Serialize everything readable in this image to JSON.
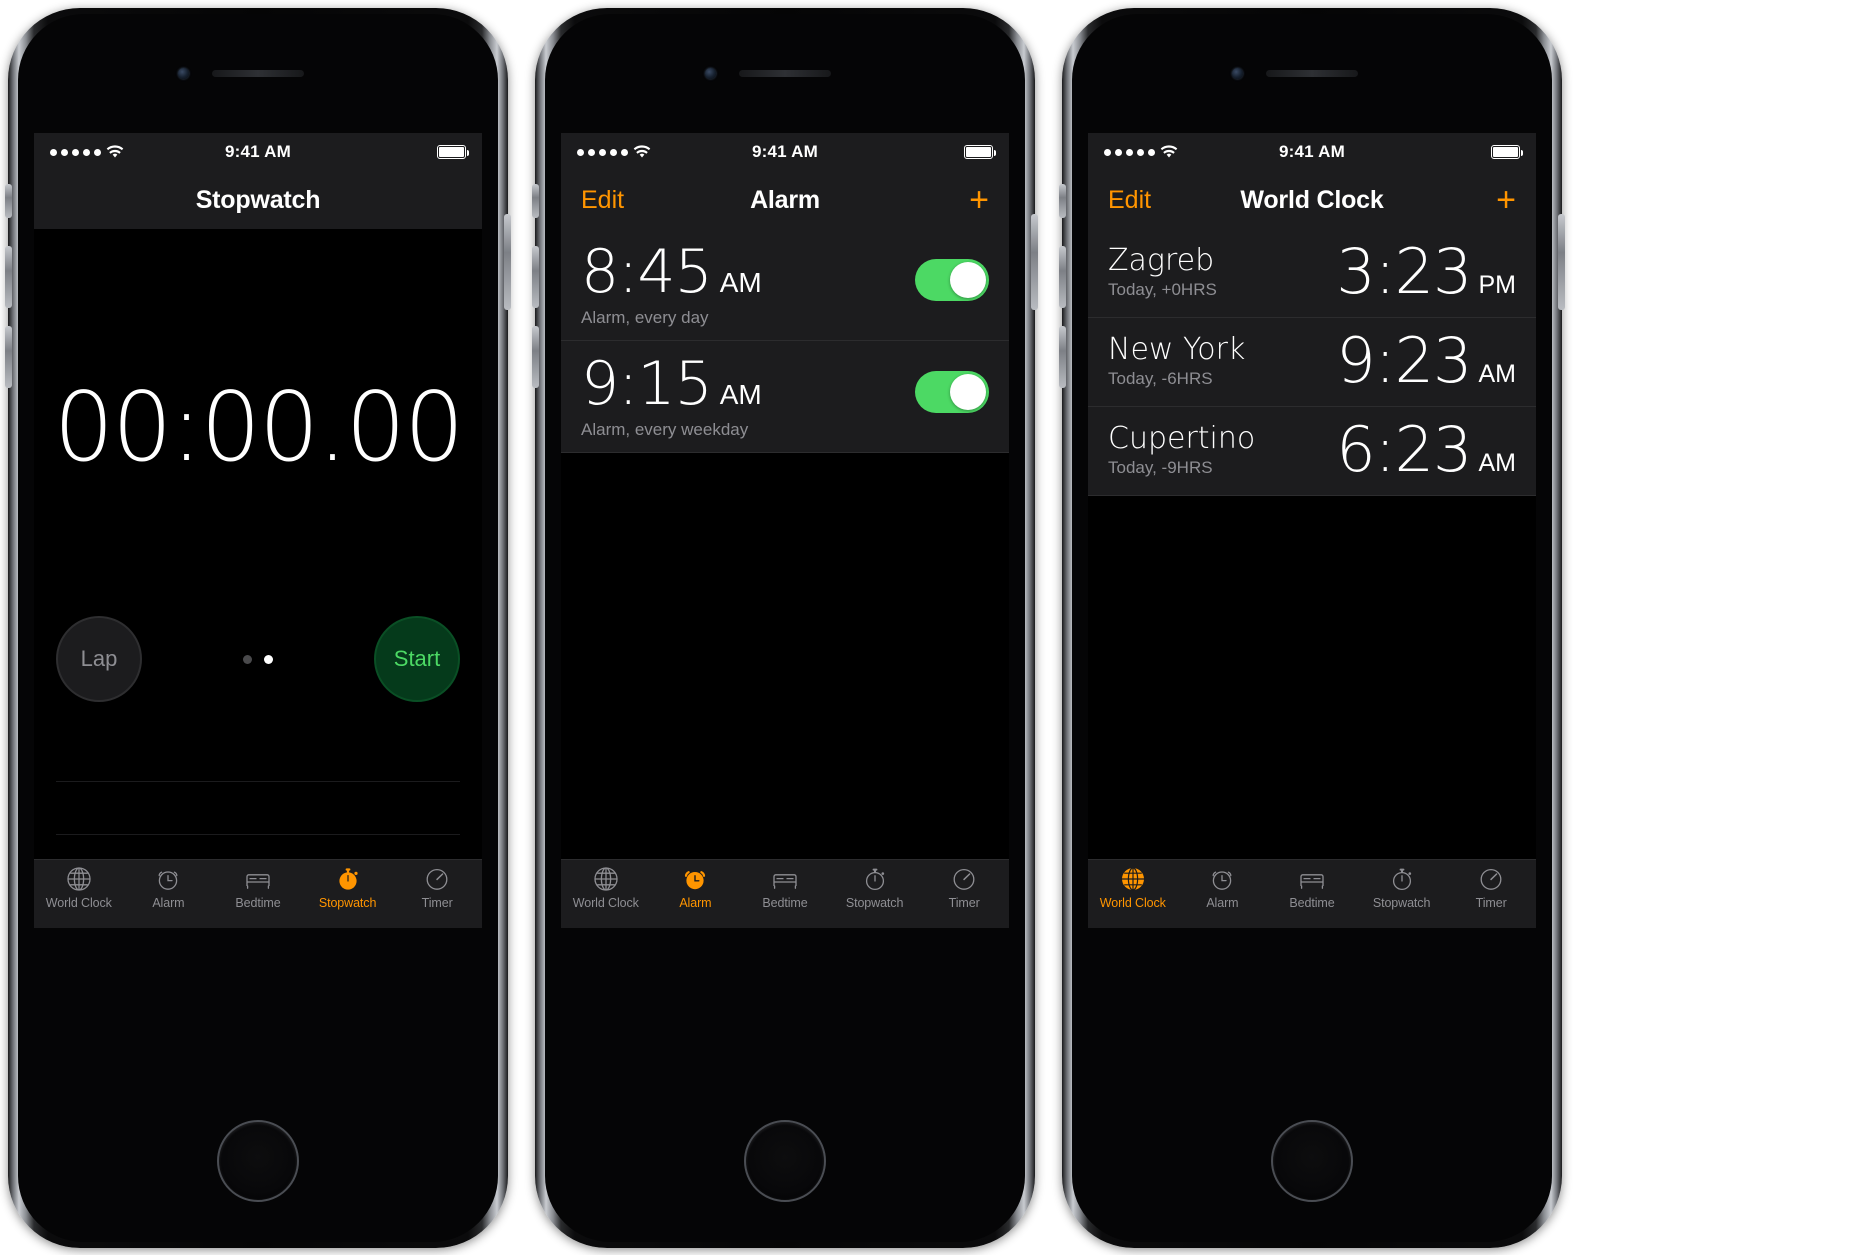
{
  "colors": {
    "accent_orange": "#ff9500",
    "toggle_green": "#4cd964",
    "start_green_text": "#4cd964",
    "start_green_fill": "#053a1b",
    "screen_bg": "#000000",
    "bar_bg": "#1c1c1e",
    "secondary_text": "#8e8e93"
  },
  "status_bar": {
    "signal_dots": 5,
    "wifi_icon": "wifi-icon",
    "time": "9:41 AM",
    "battery_icon": "battery-full-icon",
    "battery_level_percent": 100
  },
  "tab_bar": {
    "items": [
      {
        "label": "World Clock",
        "icon": "globe-icon"
      },
      {
        "label": "Alarm",
        "icon": "alarm-clock-icon"
      },
      {
        "label": "Bedtime",
        "icon": "bed-icon"
      },
      {
        "label": "Stopwatch",
        "icon": "stopwatch-icon"
      },
      {
        "label": "Timer",
        "icon": "timer-icon"
      }
    ]
  },
  "phones": [
    {
      "id": "stopwatch-phone",
      "nav": {
        "left_label": "",
        "title": "Stopwatch",
        "right_label": ""
      },
      "active_tab": "Stopwatch",
      "stopwatch": {
        "elapsed": "00:00.00",
        "lap_label": "Lap",
        "start_label": "Start",
        "page_dots": 2,
        "active_dot_index": 1,
        "lap_row_count": 4
      }
    },
    {
      "id": "alarm-phone",
      "nav": {
        "left_label": "Edit",
        "title": "Alarm",
        "right_label": "+"
      },
      "active_tab": "Alarm",
      "alarms": [
        {
          "time": "8:45",
          "ampm": "AM",
          "subtitle": "Alarm, every day",
          "enabled": true
        },
        {
          "time": "9:15",
          "ampm": "AM",
          "subtitle": "Alarm, every weekday",
          "enabled": true
        }
      ]
    },
    {
      "id": "world-clock-phone",
      "nav": {
        "left_label": "Edit",
        "title": "World Clock",
        "right_label": "+"
      },
      "active_tab": "World Clock",
      "cities": [
        {
          "city": "Zagreb",
          "subtitle": "Today, +0HRS",
          "time": "3:23",
          "ampm": "PM"
        },
        {
          "city": "New York",
          "subtitle": "Today, -6HRS",
          "time": "9:23",
          "ampm": "AM"
        },
        {
          "city": "Cupertino",
          "subtitle": "Today, -9HRS",
          "time": "6:23",
          "ampm": "AM"
        }
      ]
    }
  ]
}
